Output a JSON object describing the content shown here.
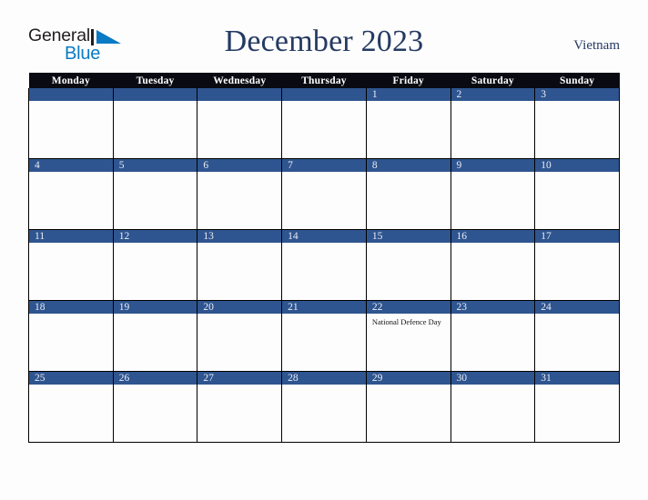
{
  "logo": {
    "word1": "General",
    "word2": "Blue",
    "mark": "triangle-mark",
    "word1_color": "#231f20",
    "word2_color": "#0b7ac4"
  },
  "header": {
    "title": "December 2023",
    "country": "Vietnam",
    "title_color": "#253a62"
  },
  "colors": {
    "header_row_bg": "#0a0a12",
    "date_bar_bg": "#2f5590",
    "date_text": "#e9edf5",
    "cell_bg": "#fdfdfd",
    "grid_line": "#000000",
    "page_bg": "#fdfdfd"
  },
  "calendar": {
    "month": "December",
    "year": "2023",
    "weekday_headers": [
      "Monday",
      "Tuesday",
      "Wednesday",
      "Thursday",
      "Friday",
      "Saturday",
      "Sunday"
    ],
    "weeks": [
      [
        {
          "day": "",
          "events": []
        },
        {
          "day": "",
          "events": []
        },
        {
          "day": "",
          "events": []
        },
        {
          "day": "",
          "events": []
        },
        {
          "day": "1",
          "events": []
        },
        {
          "day": "2",
          "events": []
        },
        {
          "day": "3",
          "events": []
        }
      ],
      [
        {
          "day": "4",
          "events": []
        },
        {
          "day": "5",
          "events": []
        },
        {
          "day": "6",
          "events": []
        },
        {
          "day": "7",
          "events": []
        },
        {
          "day": "8",
          "events": []
        },
        {
          "day": "9",
          "events": []
        },
        {
          "day": "10",
          "events": []
        }
      ],
      [
        {
          "day": "11",
          "events": []
        },
        {
          "day": "12",
          "events": []
        },
        {
          "day": "13",
          "events": []
        },
        {
          "day": "14",
          "events": []
        },
        {
          "day": "15",
          "events": []
        },
        {
          "day": "16",
          "events": []
        },
        {
          "day": "17",
          "events": []
        }
      ],
      [
        {
          "day": "18",
          "events": []
        },
        {
          "day": "19",
          "events": []
        },
        {
          "day": "20",
          "events": []
        },
        {
          "day": "21",
          "events": []
        },
        {
          "day": "22",
          "events": [
            "National Defence Day"
          ]
        },
        {
          "day": "23",
          "events": []
        },
        {
          "day": "24",
          "events": []
        }
      ],
      [
        {
          "day": "25",
          "events": []
        },
        {
          "day": "26",
          "events": []
        },
        {
          "day": "27",
          "events": []
        },
        {
          "day": "28",
          "events": []
        },
        {
          "day": "29",
          "events": []
        },
        {
          "day": "30",
          "events": []
        },
        {
          "day": "31",
          "events": []
        }
      ]
    ]
  }
}
